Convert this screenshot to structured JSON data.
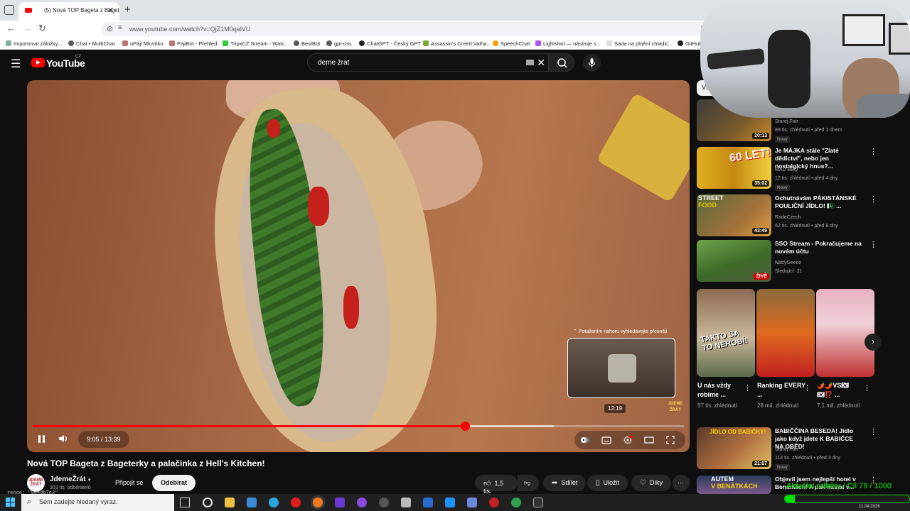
{
  "browser": {
    "tab_title": "(5) Nová TOP Bageta z Bageterky a palačinka z Hell's Kitchen! - YouTube",
    "url": "www.youtube.com/watch?v=QjZ1M0qalVU",
    "bookmarks": [
      "Importovat záložky...",
      "Chat • MultiChat",
      "uPaji Mluvítko",
      "PajiBot - Přehled",
      "TripxCZ Stream - Watc...",
      "BestBot",
      "gpt-oss",
      "ChatGPT - Český GPT",
      "Assassin's Creed Valha...",
      "SpeechChat",
      "Lightshot — nástroje s...",
      "Sada na plnění chladic...",
      "GitHub"
    ]
  },
  "youtube": {
    "logo_text": "YouTube",
    "country_code": "CZ",
    "search_query": "deme žrat"
  },
  "player": {
    "seek_hint": "⌃ Potažením nahoru vyhledávejte přesněji",
    "preview_time": "12:19",
    "watermark": "JDEME ŽRÁT",
    "time_display": "9:05 / 13:39",
    "played_fraction": 0.664,
    "buffered_fraction": 0.8,
    "controls": [
      "pause",
      "volume",
      "autoplay",
      "subtitles",
      "settings",
      "theater",
      "fullscreen"
    ]
  },
  "video": {
    "title": "Nová TOP Bageta z Bageterky a palačinka z Hell's Kitchen!",
    "channel_name": "JdemeŽrát",
    "channel_avatar_text": "JDEME ŽRÁT",
    "subscribers": "303 tis. odběratelů",
    "join_label": "Připojit se",
    "subscribe_label": "Odebírat",
    "likes": "1,5 tis.",
    "share_label": "Sdílet",
    "save_label": "Uložit",
    "thanks_label": "Díky",
    "ghost_text": "rence: \"9e4db7e3\""
  },
  "sidebar": {
    "chip_label": "Vše",
    "recommendations": [
      {
        "title": "",
        "channel": "Starej Fotr",
        "stats": "89 tis. zhlédnutí • před 1 dnem",
        "badge": "Nový",
        "duration": "20:13"
      },
      {
        "title": "Je MÁJKA stále \"Zlaté dědictví\", nebo jen nostalgický hnus?...",
        "channel": "MAD BBQ",
        "stats": "12 tis. zhlédnutí • před 4 dny",
        "badge": "Nový",
        "duration": "35:02"
      },
      {
        "title": "Ochutnávám PÁKISTÁNSKÉ POULIČNÍ JÍDLO! 🇵🇰 ...",
        "channel": "RadeCzech",
        "stats": "62 tis. zhlédnutí • před 8 dny",
        "badge": "",
        "duration": "43:49"
      },
      {
        "title": "SSO Stream - Pokračujeme na novém účtu",
        "channel": "NattyGeece",
        "stats": "Sledující: 21",
        "badge": "",
        "duration": "ŽIVĚ"
      },
      {
        "title": "BABIČČINA BESEDA! Jídlo jako když jdete K BABIČCE NA OBĚD!",
        "channel": "Starej Fotr",
        "stats": "114 tis. zhlédnutí • před 3 dny",
        "badge": "Nový",
        "duration": "21:07"
      },
      {
        "title": "Objevil jsem nejlepší hotel v Benátkách! A pak nastal v...",
        "channel": "",
        "stats": "",
        "badge": "",
        "duration": ""
      }
    ],
    "shorts": [
      {
        "title": "U nás vždy robíme ...",
        "views": "57 tis. zhlédnutí",
        "thumb_text": "TAKTO SA TO NEROBÍ!"
      },
      {
        "title": "Ranking EVERY ...",
        "views": "28 mil. zhlédnutí",
        "thumb_text": ""
      },
      {
        "title": "🌶️🌶️VS🇰🇷 🇰🇷⁉️ ...",
        "views": "7,1 mil. zhlédnutí",
        "thumb_text": ""
      }
    ]
  },
  "overlay": {
    "goal_text": "Aktuální odběry / Cíl 79 / 1000",
    "goal_current": 79,
    "goal_target": 1000,
    "colors": {
      "accent": "#ff0000",
      "goal": "#00e000"
    }
  },
  "taskbar": {
    "search_placeholder": "Sem zadejte hledaný výraz.",
    "date": "11.04.2026"
  }
}
